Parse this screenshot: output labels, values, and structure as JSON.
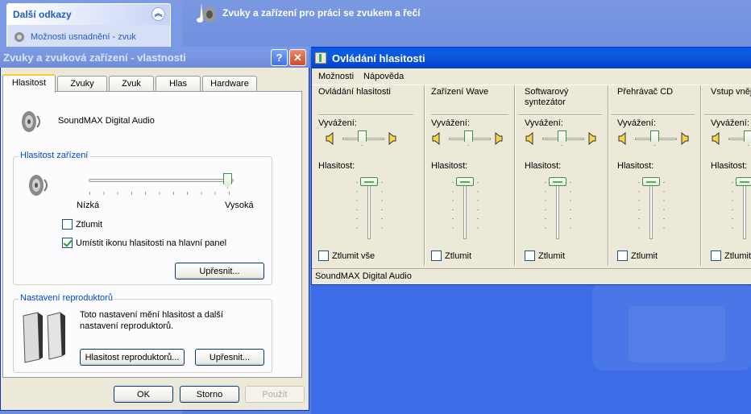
{
  "control_panel": {
    "links_title": "Další odkazy",
    "links_item": "Možnosti usnadnění - zvuk",
    "header_title": "Zvuky a zařízení pro práci se zvukem a řečí"
  },
  "sound_dialog": {
    "title": "Zvuky a zvuková zařízení - vlastnosti",
    "help_glyph": "?",
    "close_glyph": "✕",
    "tabs": [
      "Hlasitost",
      "Zvuky",
      "Zvuk",
      "Hlas",
      "Hardware"
    ],
    "device_name": "SoundMAX Digital Audio",
    "device_volume_group": "Hlasitost zařízení",
    "slider_low": "Nízká",
    "slider_high": "Vysoká",
    "device_volume_level": 1.0,
    "mute_label": "Ztlumit",
    "mute_checked": false,
    "tray_icon_label": "Umístit ikonu hlasitosti na hlavní panel",
    "tray_icon_checked": true,
    "advanced_button": "Upřesnit...",
    "speaker_group": "Nastavení reproduktorů",
    "speaker_text_1": "Toto nastavení mění hlasitost a další",
    "speaker_text_2": "nastavení reproduktorů.",
    "speaker_volume_button": "Hlasitost reproduktorů...",
    "speaker_advanced_button": "Upřesnit...",
    "ok": "OK",
    "cancel": "Storno",
    "apply": "Použít"
  },
  "volume_control": {
    "title": "Ovládání hlasitosti",
    "menu": [
      "Možnosti",
      "Nápověda"
    ],
    "balance_label": "Vyvážení:",
    "volume_label": "Hlasitost:",
    "columns": [
      {
        "title_1": "Ovládání hlasitosti",
        "title_2": "",
        "mute": "Ztlumit vše"
      },
      {
        "title_1": "Zařízení Wave",
        "title_2": "",
        "mute": "Ztlumit"
      },
      {
        "title_1": "Softwarový",
        "title_2": "syntezátor",
        "mute": "Ztlumit"
      },
      {
        "title_1": "Přehrávač CD",
        "title_2": "",
        "mute": "Ztlumit"
      },
      {
        "title_1": "Vstup vnější",
        "title_2": "",
        "mute": "Ztlumit"
      }
    ],
    "status": "SoundMAX Digital Audio",
    "colors": {
      "active_title": "#0a5ae8",
      "inactive_title": "#7b9be6",
      "face": "#ece9d8"
    }
  }
}
